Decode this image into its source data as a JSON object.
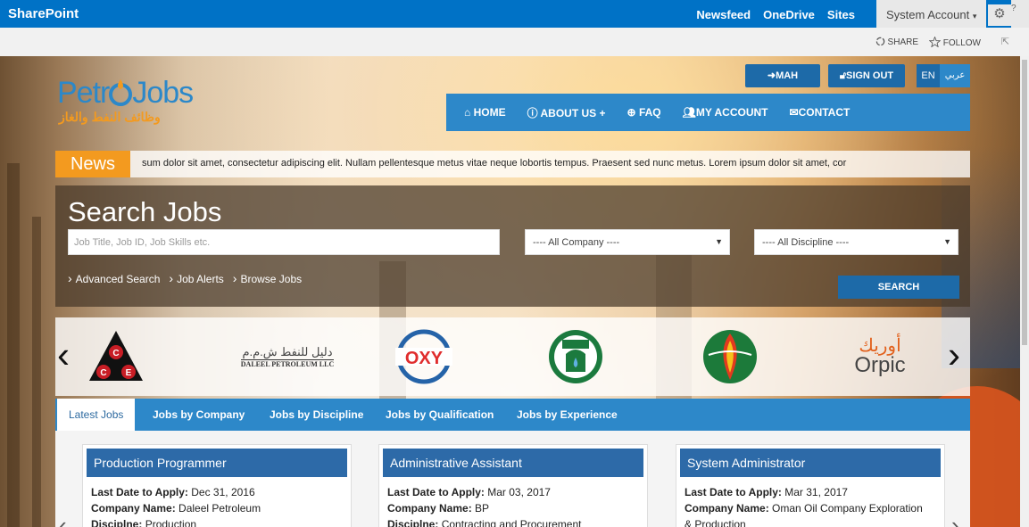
{
  "suitebar": {
    "brand": "SharePoint",
    "links": [
      "Newsfeed",
      "OneDrive",
      "Sites"
    ],
    "account": "System Account",
    "account_caret": "▾",
    "gear": "⚙",
    "help": "?"
  },
  "ribbon": {
    "share": "SHARE",
    "follow": "FOLLOW",
    "share_icon": "sync-icon",
    "follow_icon": "star-icon"
  },
  "logo": {
    "text_a": "Petr",
    "text_b": "Jobs",
    "arabic": "وظائف النفط والغاز"
  },
  "header": {
    "user_button": "MAH",
    "signout_button": "SIGN OUT",
    "lang_en": "EN",
    "lang_ar": "عربي"
  },
  "nav": {
    "items": [
      {
        "icon": "home-icon",
        "label": "HOME"
      },
      {
        "icon": "info-icon",
        "label": "ABOUT US"
      },
      {
        "icon": "support-icon",
        "label": "FAQ"
      },
      {
        "icon": "users-icon",
        "label": "MY ACCOUNT"
      },
      {
        "icon": "mail-icon",
        "label": "CONTACT"
      }
    ],
    "about_plus": "+"
  },
  "news": {
    "label": "News",
    "ticker": "sum dolor sit amet, consectetur adipiscing elit. Nullam pellentesque metus vitae neque lobortis tempus. Praesent sed nunc metus.    Lorem ipsum dolor sit amet, cor"
  },
  "search": {
    "title": "Search Jobs",
    "keyword_placeholder": "Job Title, Job ID, Job Skills etc.",
    "company_selected": "---- All Company ----",
    "discipline_selected": "---- All Discipline ----",
    "links": [
      "Advanced Search",
      "Job Alerts",
      "Browse Jobs"
    ],
    "button": "SEARCH"
  },
  "carousel": {
    "prev": "‹",
    "next": "›",
    "logos": [
      {
        "name": "cce-logo",
        "text": "CCE"
      },
      {
        "name": "daleel-petroleum-logo",
        "arabic": "دليل للنفط ش.م.م",
        "text": "DALEEL PETROLEUM LLC"
      },
      {
        "name": "oxy-logo",
        "text": "OXY"
      },
      {
        "name": "petroleum-development-logo",
        "text": ""
      },
      {
        "name": "oman-oil-logo",
        "text": ""
      },
      {
        "name": "orpic-logo",
        "arabic": "أوريك",
        "text": "Orpic"
      }
    ]
  },
  "tabs": [
    "Latest Jobs",
    "Jobs by Company",
    "Jobs by Discipline",
    "Jobs by Qualification",
    "Jobs by Experience"
  ],
  "jobs": [
    {
      "title": "Production Programmer",
      "date_label": "Last Date to Apply:",
      "date": "Dec 31, 2016",
      "company_label": "Company Name:",
      "company": "Daleel Petroleum",
      "discipline_label": "Disciplne:",
      "discipline": "Production"
    },
    {
      "title": "Administrative Assistant",
      "date_label": "Last Date to Apply:",
      "date": "Mar 03, 2017",
      "company_label": "Company Name:",
      "company": "BP",
      "discipline_label": "Disciplne:",
      "discipline": "Contracting and Procurement"
    },
    {
      "title": "System Administrator",
      "date_label": "Last Date to Apply:",
      "date": "Mar 31, 2017",
      "company_label": "Company Name:",
      "company": "Oman Oil Company Exploration",
      "discipline_label": "",
      "discipline": "& Production"
    }
  ],
  "colors": {
    "suitebar": "#0072c6",
    "nav_blue": "#2d88c9",
    "dark_blue": "#1d6aa8",
    "news_orange": "#f39a1f"
  }
}
